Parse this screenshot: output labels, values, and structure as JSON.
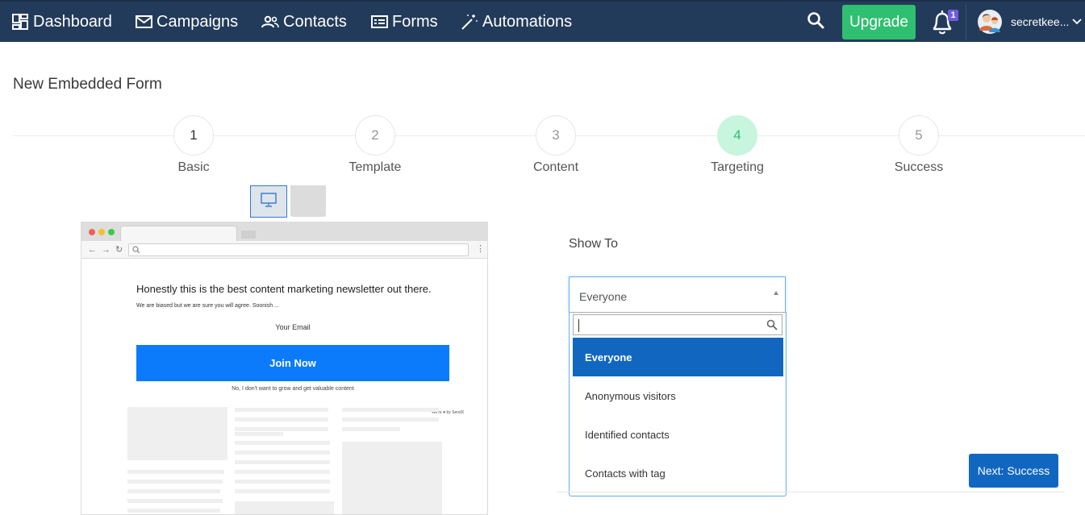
{
  "nav": {
    "items": [
      {
        "label": "Dashboard",
        "icon": "dashboard-icon"
      },
      {
        "label": "Campaigns",
        "icon": "envelope-icon"
      },
      {
        "label": "Contacts",
        "icon": "users-icon"
      },
      {
        "label": "Forms",
        "icon": "form-icon"
      },
      {
        "label": "Automations",
        "icon": "magic-wand-icon"
      }
    ],
    "upgrade_label": "Upgrade",
    "notification_count": "1",
    "username": "secretkee...",
    "colors": {
      "nav_bg": "#233b5a",
      "upgrade": "#2fbf71",
      "badge": "#6f5bdc"
    }
  },
  "page": {
    "title": "New Embedded Form"
  },
  "steps": [
    {
      "number": "1",
      "label": "Basic",
      "state": "done"
    },
    {
      "number": "2",
      "label": "Template",
      "state": "todo"
    },
    {
      "number": "3",
      "label": "Content",
      "state": "todo"
    },
    {
      "number": "4",
      "label": "Targeting",
      "state": "active"
    },
    {
      "number": "5",
      "label": "Success",
      "state": "todo"
    }
  ],
  "preview": {
    "form_title": "Honestly this is the best content marketing newsletter out there.",
    "form_subtitle": "We are biased but we are sure you will agree. Soonish ...",
    "email_label": "Your Email",
    "join_label": "Join Now",
    "decline_label": "No, I don't want to grow and get valuable content",
    "brand_label": "We're ♥ by SendX",
    "colors": {
      "join_button": "#0c7bfb"
    }
  },
  "targeting": {
    "show_to_label": "Show To",
    "selected_value": "Everyone",
    "search_value": "",
    "options": [
      "Everyone",
      "Anonymous visitors",
      "Identified contacts",
      "Contacts with tag"
    ],
    "colors": {
      "selected_option": "#1167c0",
      "focus_border": "#66afe9"
    }
  },
  "actions": {
    "next_label": "Next: Success"
  }
}
